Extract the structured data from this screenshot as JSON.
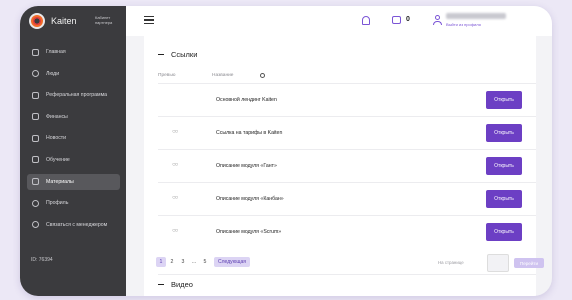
{
  "sidebar": {
    "brand_name": "Kaiten",
    "brand_sub": "Кабинет партнера",
    "items": [
      {
        "label": "Главная",
        "icon": "home-icon"
      },
      {
        "label": "Люди",
        "icon": "people-icon"
      },
      {
        "label": "Реферальная программа",
        "icon": "referral-icon"
      },
      {
        "label": "Финансы",
        "icon": "wallet-icon"
      },
      {
        "label": "Новости",
        "icon": "news-icon"
      },
      {
        "label": "Обучение",
        "icon": "learning-icon"
      },
      {
        "label": "Материалы",
        "icon": "materials-icon"
      },
      {
        "label": "Профиль",
        "icon": "profile-icon"
      },
      {
        "label": "Связаться с менеджером",
        "icon": "chat-icon"
      }
    ],
    "active_index": 6,
    "user_id": "ID: 76394"
  },
  "topbar": {
    "cart_count": "0",
    "profile_link": "Выйти из профиля"
  },
  "links_section": {
    "title": "Ссылки",
    "col_preview": "Превью",
    "col_name": "Название",
    "rows": [
      {
        "name": "Основной лендинг Kaiten",
        "has_preview": false,
        "button": "Открыть"
      },
      {
        "name": "Ссылка на тарифы в Kaiten",
        "has_preview": true,
        "button": "Открыть"
      },
      {
        "name": "Описание модуля «Гант»",
        "has_preview": true,
        "button": "Открыть"
      },
      {
        "name": "Описание модуля «Канбан»",
        "has_preview": true,
        "button": "Открыть"
      },
      {
        "name": "Описание модуля «Scrum»",
        "has_preview": true,
        "button": "Открыть"
      }
    ]
  },
  "pagination": {
    "pages": [
      "1",
      "2",
      "3",
      "...",
      "5"
    ],
    "current": "1",
    "next_label": "Следующая",
    "per_page_label": "На странице",
    "go_label": "Перейти"
  },
  "video_section": {
    "title": "Видео"
  },
  "colors": {
    "accent": "#6c3fc4",
    "sidebar_bg": "#3b3b3e"
  }
}
